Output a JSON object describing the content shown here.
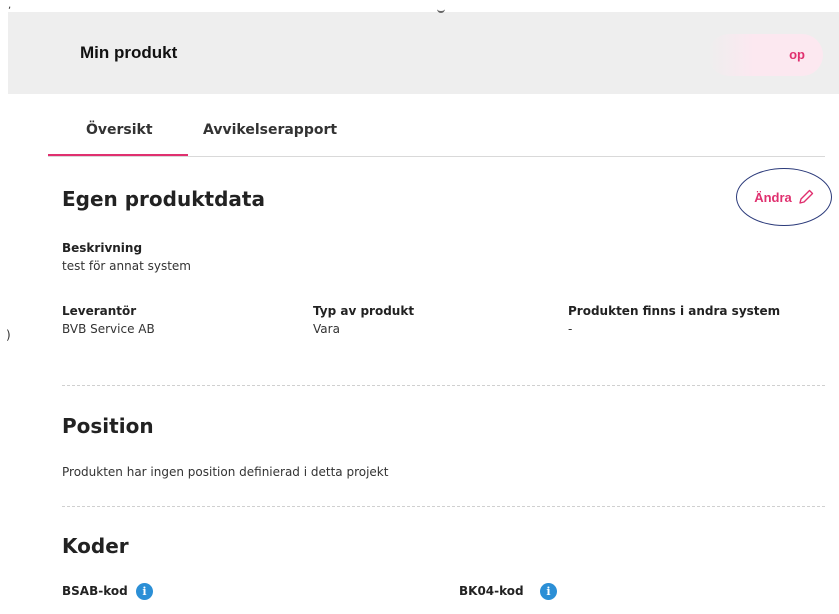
{
  "header": {
    "title": "Min produkt",
    "button_label": "op"
  },
  "tabs": [
    {
      "label": "Översikt",
      "active": true
    },
    {
      "label": "Avvikelserapport",
      "active": false
    }
  ],
  "own_product_data": {
    "title": "Egen produktdata",
    "edit_label": "Ändra",
    "description": {
      "label": "Beskrivning",
      "value": "test för annat system"
    },
    "supplier": {
      "label": "Leverantör",
      "value": "BVB Service AB"
    },
    "product_type": {
      "label": "Typ av produkt",
      "value": "Vara"
    },
    "other_systems": {
      "label": "Produkten finns i andra system",
      "value": "-"
    }
  },
  "position": {
    "title": "Position",
    "text": "Produkten har ingen position definierad i detta projekt"
  },
  "codes": {
    "title": "Koder",
    "bsab_label": "BSAB-kod",
    "bk04_label": "BK04-kod"
  },
  "colors": {
    "accent": "#e0306f",
    "info": "#2b8fd6",
    "header_bg": "#eeeeee",
    "highlight_circle": "#2b3a7a"
  }
}
